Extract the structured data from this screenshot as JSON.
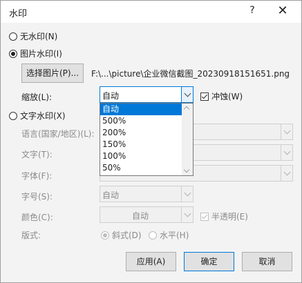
{
  "dialog": {
    "title": "水印",
    "help_label": "?",
    "close_label": "✕"
  },
  "options": {
    "no_watermark": "无水印(N)",
    "picture_watermark": "图片水印(I)",
    "text_watermark": "文字水印(X)"
  },
  "picture": {
    "select_button": "选择图片(P)...",
    "path": "F:\\...\\picture\\企业微信截图_20230918151651.png",
    "scale_label": "缩放(L):",
    "scale_value": "自动",
    "washout_label": "冲蚀(W)",
    "washout_checked": true
  },
  "scale_dropdown": {
    "items": [
      "自动",
      "500%",
      "200%",
      "150%",
      "100%",
      "50%"
    ],
    "selected_index": 0
  },
  "text": {
    "language_label": "语言(国家/地区)(L):",
    "text_label": "文字(T):",
    "font_label": "字体(F):",
    "size_label": "字号(S):",
    "size_value": "自动",
    "color_label": "颜色(C):",
    "color_value": "自动",
    "semitransparent_label": "半透明(E)",
    "layout_label": "版式:",
    "diagonal_label": "斜式(D)",
    "horizontal_label": "水平(H)"
  },
  "buttons": {
    "apply": "应用(A)",
    "ok": "确定",
    "cancel": "取消"
  },
  "colors": {
    "accent": "#0078d7",
    "disabled_text": "#8a8a8a"
  }
}
